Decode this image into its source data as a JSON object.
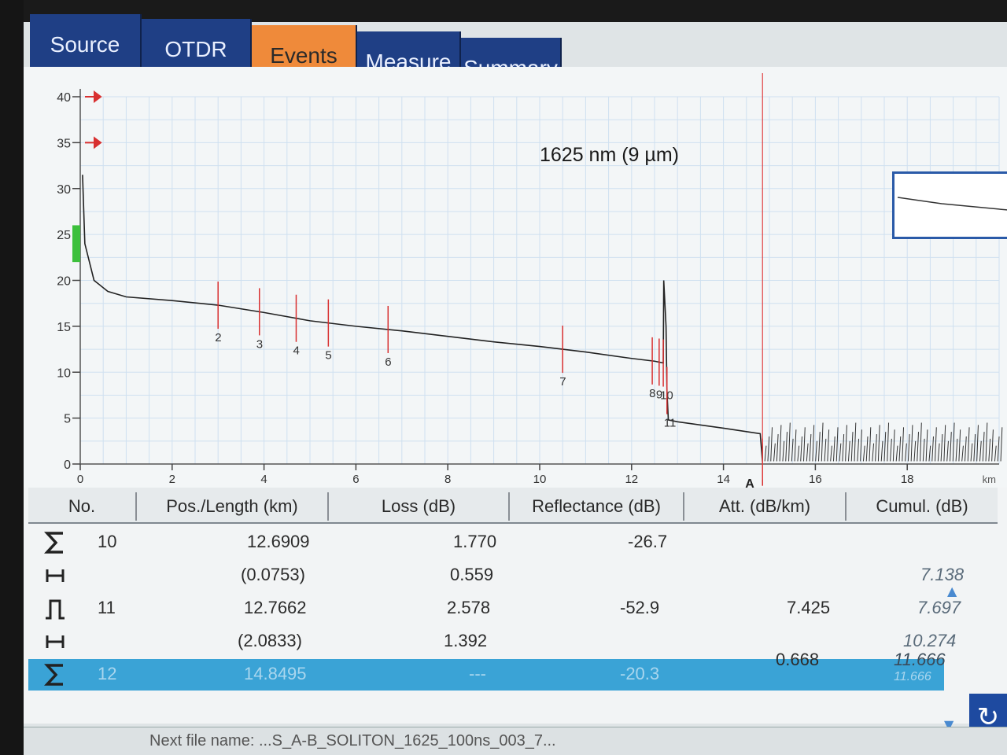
{
  "tabs": [
    {
      "label": "Source"
    },
    {
      "label": "OTDR"
    },
    {
      "label": "Events",
      "active": true
    },
    {
      "label": "Measure"
    },
    {
      "label": "Summary"
    }
  ],
  "graph": {
    "wavelength_label": "1625 nm (9 µm)",
    "x_unit": "km",
    "marker_a": "A"
  },
  "chart_data": {
    "type": "line",
    "title": "1625 nm (9 µm)",
    "xlabel": "km",
    "ylabel": "",
    "xlim": [
      0,
      20
    ],
    "ylim": [
      0,
      40
    ],
    "x_ticks": [
      0,
      2,
      4,
      6,
      8,
      10,
      12,
      14,
      16,
      18
    ],
    "y_ticks": [
      0,
      5,
      10,
      15,
      20,
      25,
      30,
      35,
      40
    ],
    "grid": true,
    "series": [
      {
        "x": [
          0.05,
          0.1,
          0.3,
          0.6,
          1.0,
          2.0,
          3.0,
          4.0,
          5.0,
          6.0,
          7.0,
          8.0,
          9.0,
          10.0,
          11.0,
          12.0,
          12.5,
          12.69,
          12.7,
          12.75,
          12.77,
          12.8,
          13.0,
          14.0,
          14.8,
          14.85
        ],
        "y": [
          31.5,
          24.0,
          20.0,
          18.8,
          18.2,
          17.8,
          17.3,
          16.5,
          15.6,
          15.0,
          14.5,
          13.9,
          13.3,
          12.8,
          12.2,
          11.5,
          11.2,
          11.0,
          20.0,
          15.0,
          8.0,
          4.8,
          4.6,
          3.9,
          3.3,
          0.2
        ]
      }
    ],
    "events": [
      {
        "label": "2",
        "x": 3.0
      },
      {
        "label": "3",
        "x": 3.9
      },
      {
        "label": "4",
        "x": 4.7
      },
      {
        "label": "5",
        "x": 5.4
      },
      {
        "label": "6",
        "x": 6.7
      },
      {
        "label": "7",
        "x": 10.5
      },
      {
        "label": "8",
        "x": 12.45
      },
      {
        "label": "9",
        "x": 12.6
      },
      {
        "label": "10",
        "x": 12.69
      },
      {
        "label": "11",
        "x": 12.77
      },
      {
        "label": "12",
        "x": 14.85
      }
    ]
  },
  "table": {
    "headers": [
      "No.",
      "Pos./Length (km)",
      "Loss (dB)",
      "Reflectance (dB)",
      "Att. (dB/km)",
      "Cumul. (dB)"
    ],
    "rows": [
      {
        "icon": "sigma-icon",
        "no": "10",
        "pos": "12.6909",
        "loss": "1.770",
        "refl": "-26.7",
        "att": "",
        "cumul": ""
      },
      {
        "icon": "span-icon",
        "no": "",
        "pos": "(0.0753)",
        "loss": "0.559",
        "refl": "",
        "att": "",
        "cumul": "7.138"
      },
      {
        "icon": "pulse-icon",
        "no": "11",
        "pos": "12.7662",
        "loss": "2.578",
        "refl": "-52.9",
        "att": "7.425",
        "cumul": "7.697"
      },
      {
        "icon": "span-icon",
        "no": "",
        "pos": "(2.0833)",
        "loss": "1.392",
        "refl": "",
        "att": "",
        "cumul": "10.274"
      },
      {
        "icon": "sigma-icon",
        "no": "12",
        "pos": "14.8495",
        "loss": "---",
        "refl": "-20.3",
        "att": "0.668",
        "cumul": "11.666",
        "selected": true
      }
    ],
    "selected_cumul": "11.666"
  },
  "status": {
    "text": "Next file name: ...S_A-B_SOLITON_1625_100ns_003_7..."
  }
}
